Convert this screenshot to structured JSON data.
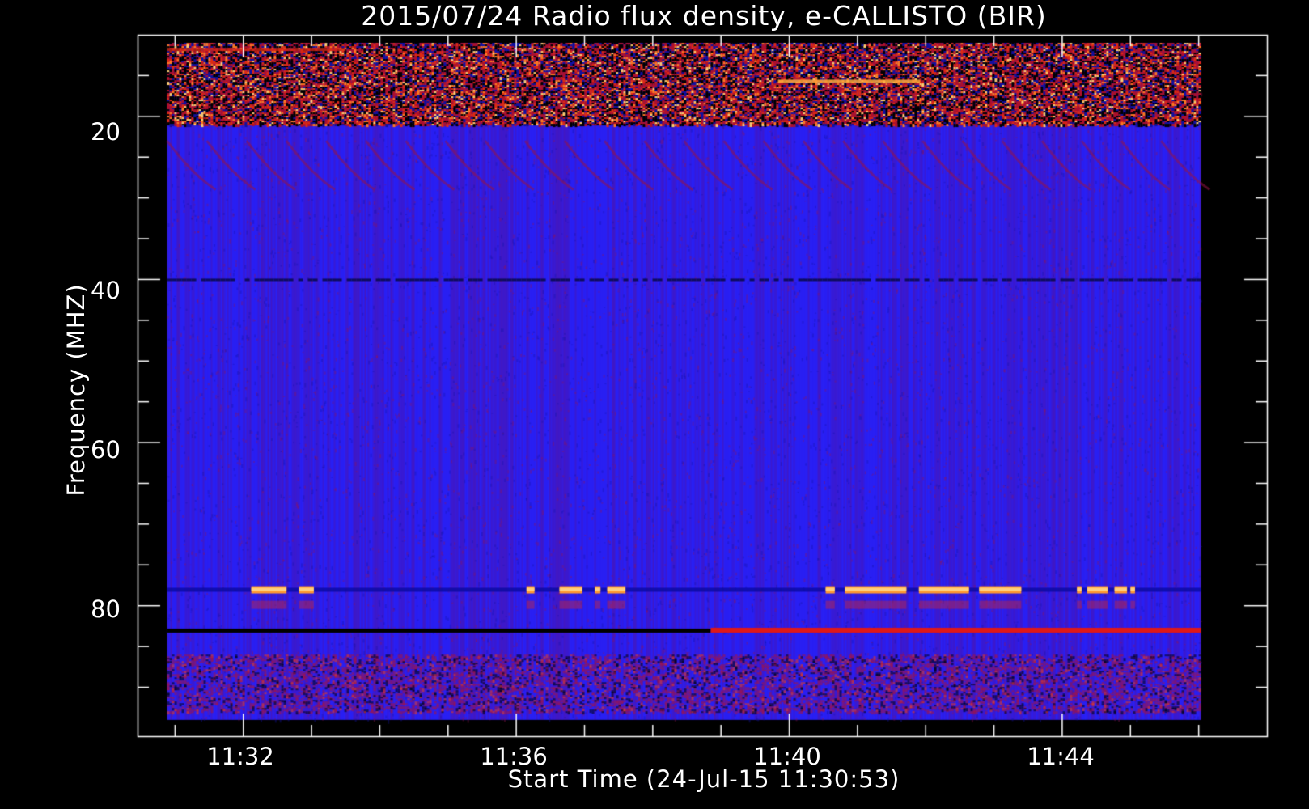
{
  "chart_data": {
    "type": "heatmap",
    "title": "2015/07/24  Radio flux density, e-CALLISTO (BIR)",
    "xlabel": "Start Time (24-Jul-15 11:30:53)",
    "ylabel": "Frequency (MHZ)",
    "x_ticks": [
      "11:32",
      "11:36",
      "11:40",
      "11:44"
    ],
    "y_ticks": [
      "20",
      "40",
      "60",
      "80"
    ],
    "xlim": [
      "11:30:53",
      "11:46:02"
    ],
    "ylim": [
      94,
      11
    ],
    "y_axis_range": [
      96,
      10
    ],
    "x_axis_range": [
      "11:30:27",
      "11:47:00"
    ],
    "colormap": [
      "#000000",
      "#3a12e8",
      "#2418ff",
      "#c0102a",
      "#ff4a10",
      "#ffe080"
    ],
    "background_color": "#2a1ff2",
    "features": [
      {
        "name": "strong interference band",
        "freq_range": [
          11,
          21
        ],
        "intensity": "high, mottled red/orange/black"
      },
      {
        "name": "faint drifting patterns",
        "freq_range": [
          22,
          31
        ],
        "intensity": "low-medium"
      },
      {
        "name": "dark line",
        "freq": 40,
        "intensity": "low"
      },
      {
        "name": "intermittent bright segments",
        "freq": 78,
        "time_segments": [
          [
            "11:32:07",
            "11:32:38"
          ],
          [
            "11:32:49",
            "11:33:02"
          ],
          [
            "11:36:09",
            "11:36:16"
          ],
          [
            "11:36:38",
            "11:36:58"
          ],
          [
            "11:37:09",
            "11:37:14"
          ],
          [
            "11:37:20",
            "11:37:36"
          ],
          [
            "11:40:32",
            "11:40:40"
          ],
          [
            "11:40:49",
            "11:41:43"
          ],
          [
            "11:41:54",
            "11:42:38"
          ],
          [
            "11:42:47",
            "11:43:24"
          ],
          [
            "11:44:13",
            "11:44:17"
          ],
          [
            "11:44:22",
            "11:44:40"
          ],
          [
            "11:44:46",
            "11:44:57"
          ],
          [
            "11:45:00",
            "11:45:04"
          ]
        ],
        "intensity": "high"
      },
      {
        "name": "line at 83 MHz",
        "freq": 83,
        "before": "dark (until ~11:38:51)",
        "after": "bright red (from ~11:38:51)"
      },
      {
        "name": "mottled band",
        "freq_range": [
          86,
          93
        ],
        "intensity": "medium"
      }
    ]
  }
}
